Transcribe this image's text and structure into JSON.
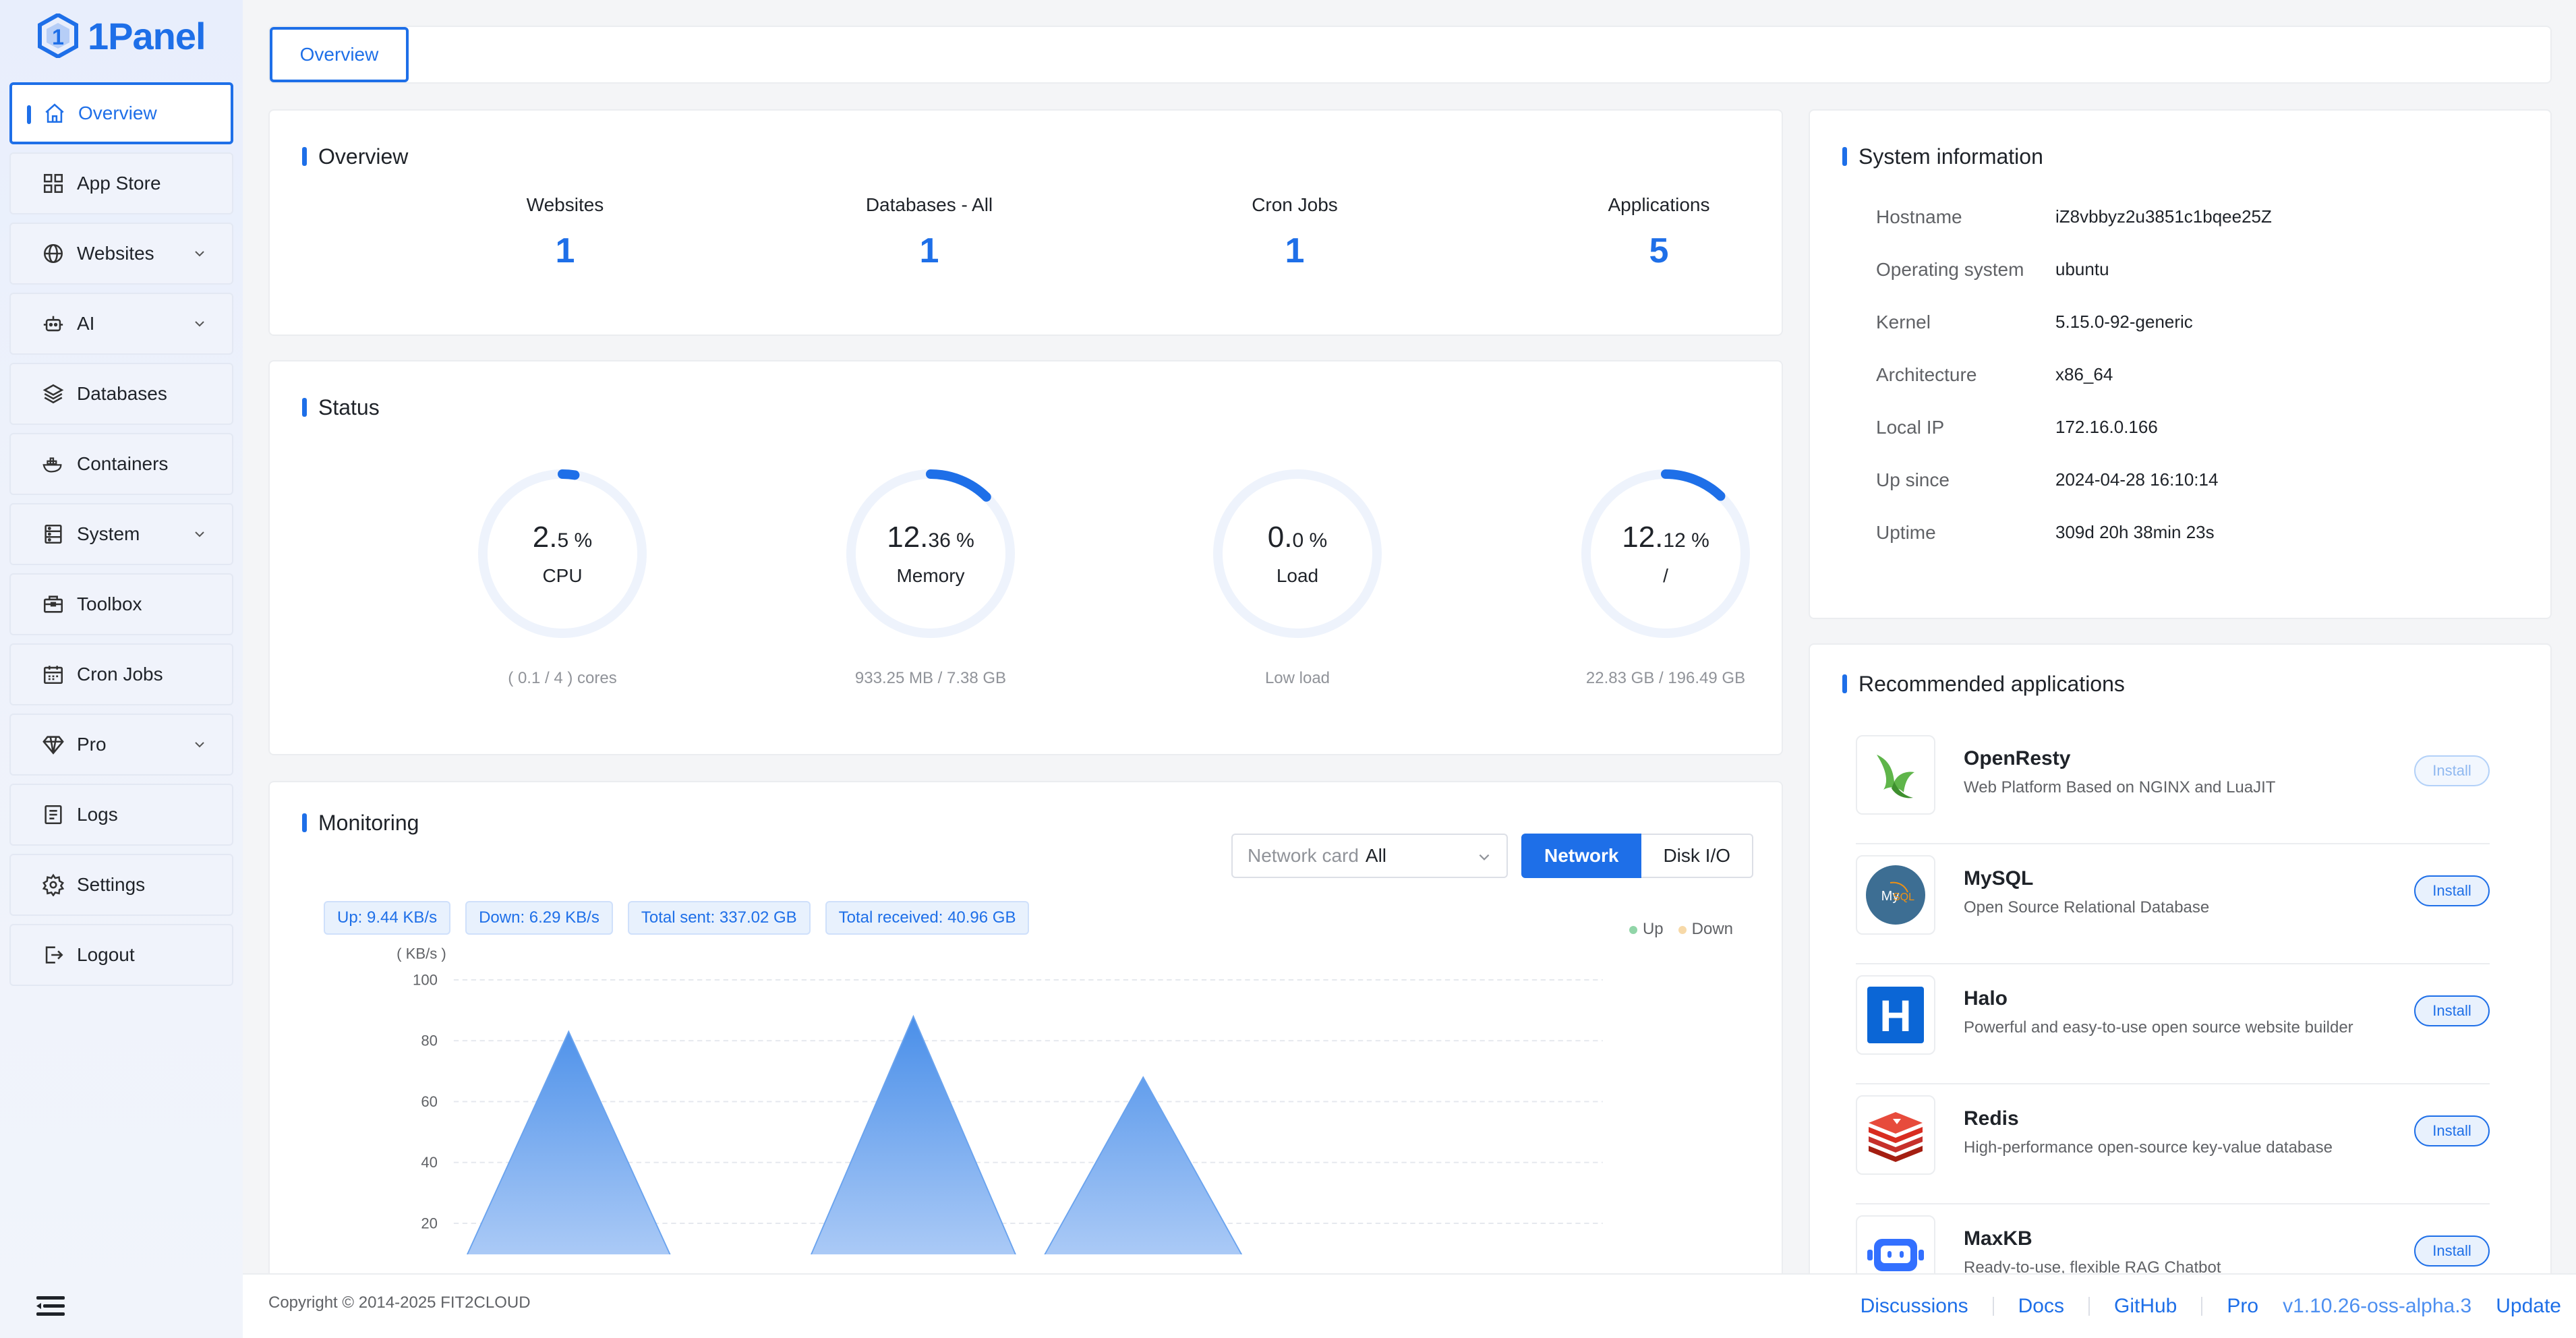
{
  "brand": {
    "name": "1Panel"
  },
  "sidebar": {
    "items": [
      {
        "label": "Overview",
        "icon": "home-icon"
      },
      {
        "label": "App Store",
        "icon": "grid-icon"
      },
      {
        "label": "Websites",
        "icon": "globe-icon"
      },
      {
        "label": "AI",
        "icon": "robot-icon"
      },
      {
        "label": "Databases",
        "icon": "layers-icon"
      },
      {
        "label": "Containers",
        "icon": "whale-icon"
      },
      {
        "label": "System",
        "icon": "server-icon"
      },
      {
        "label": "Toolbox",
        "icon": "toolbox-icon"
      },
      {
        "label": "Cron Jobs",
        "icon": "calendar-icon"
      },
      {
        "label": "Pro",
        "icon": "diamond-icon"
      },
      {
        "label": "Logs",
        "icon": "list-icon"
      },
      {
        "label": "Settings",
        "icon": "gear-icon"
      },
      {
        "label": "Logout",
        "icon": "logout-icon"
      }
    ]
  },
  "tabs": [
    {
      "label": "Overview"
    }
  ],
  "overview": {
    "title": "Overview",
    "stats": [
      {
        "label": "Websites",
        "value": "1"
      },
      {
        "label": "Databases - All",
        "value": "1"
      },
      {
        "label": "Cron Jobs",
        "value": "1"
      },
      {
        "label": "Applications",
        "value": "5"
      }
    ]
  },
  "status": {
    "title": "Status",
    "gauges": [
      {
        "int": "2.",
        "frac": "5 %",
        "name": "CPU",
        "sub": "( 0.1 / 4 ) cores",
        "percent": 2.5
      },
      {
        "int": "12.",
        "frac": "36 %",
        "name": "Memory",
        "sub": "933.25 MB / 7.38 GB",
        "percent": 12.36
      },
      {
        "int": "0.",
        "frac": "0 %",
        "name": "Load",
        "sub": "Low load",
        "percent": 0.0
      },
      {
        "int": "12.",
        "frac": "12 %",
        "name": "/",
        "sub": "22.83 GB / 196.49 GB",
        "percent": 12.12
      }
    ]
  },
  "monitoring": {
    "title": "Monitoring",
    "network_card_label": "Network card",
    "network_card_value": "All",
    "btn_network": "Network",
    "btn_disk": "Disk I/O",
    "badges": [
      "Up: 9.44 KB/s",
      "Down: 6.29 KB/s",
      "Total sent: 337.02 GB",
      "Total received: 40.96 GB"
    ],
    "legend_up": "Up",
    "legend_down": "Down"
  },
  "chart_data": {
    "type": "area",
    "ylabel": "( KB/s )",
    "ylim": [
      0,
      100
    ],
    "yticks": [
      20,
      40,
      60,
      80,
      100
    ],
    "series": [
      {
        "name": "Up",
        "values": [
          0,
          83,
          0,
          0,
          88,
          0,
          68,
          0,
          0,
          0,
          0
        ]
      },
      {
        "name": "Down",
        "values": [
          0,
          0,
          0,
          0,
          0,
          0,
          0,
          0,
          0,
          1,
          0
        ]
      }
    ],
    "grid": true,
    "legend": "top-right"
  },
  "sysinfo": {
    "title": "System information",
    "rows": [
      {
        "key": "Hostname",
        "value": "iZ8vbbyz2u3851c1bqee25Z"
      },
      {
        "key": "Operating system",
        "value": "ubuntu"
      },
      {
        "key": "Kernel",
        "value": "5.15.0-92-generic"
      },
      {
        "key": "Architecture",
        "value": "x86_64"
      },
      {
        "key": "Local IP",
        "value": "172.16.0.166"
      },
      {
        "key": "Up since",
        "value": "2024-04-28 16:10:14"
      },
      {
        "key": "Uptime",
        "value": "309d 20h 38min 23s"
      }
    ]
  },
  "apps": {
    "title": "Recommended applications",
    "items": [
      {
        "name": "OpenResty",
        "desc": "Web Platform Based on NGINX and LuaJIT",
        "button": "Install",
        "icon": "openresty-icon"
      },
      {
        "name": "MySQL",
        "desc": "Open Source Relational Database",
        "button": "Install",
        "icon": "mysql-icon"
      },
      {
        "name": "Halo",
        "desc": "Powerful and easy-to-use open source website builder",
        "button": "Install",
        "icon": "halo-icon"
      },
      {
        "name": "Redis",
        "desc": "High-performance open-source key-value database",
        "button": "Install",
        "icon": "redis-icon"
      },
      {
        "name": "MaxKB",
        "desc": "Ready-to-use, flexible RAG Chatbot",
        "button": "Install",
        "icon": "maxkb-icon"
      }
    ]
  },
  "footer": {
    "copyright": "Copyright © 2014-2025 FIT2CLOUD",
    "links": [
      "Discussions",
      "Docs",
      "GitHub",
      "Pro"
    ],
    "version": "v1.10.26-oss-alpha.3",
    "update": "Update"
  },
  "colors": {
    "accent": "#1e6fe8",
    "chart_fill": "#4a8fe9"
  }
}
